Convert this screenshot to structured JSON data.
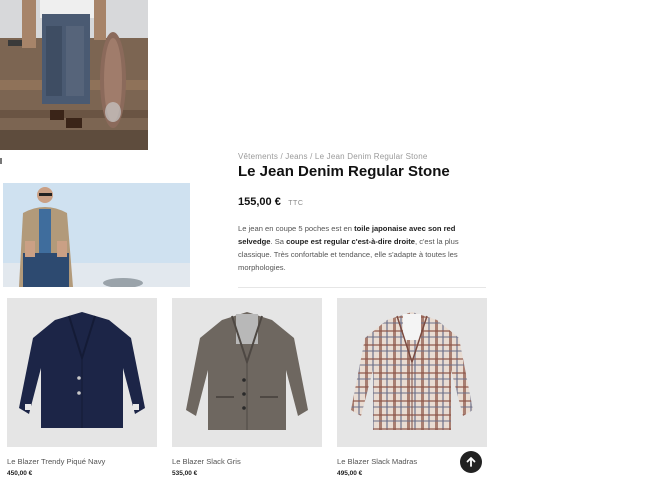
{
  "product": {
    "breadcrumb": "Vêtements / Jeans / Le Jean Denim Regular Stone",
    "title": "Le Jean Denim Regular Stone",
    "price": "155,00 €",
    "price_suffix": "TTC",
    "description": {
      "p1": "Le jean en coupe 5 poches est en ",
      "b1": "toile japonaise avec son red selvedge",
      "p2": ". Sa ",
      "b2": "coupe est regular c'est-à-dire droite",
      "p3": ", c'est la plus classique. Très confortable et tendance, elle s'adapte à toutes les morphologies."
    }
  },
  "related": [
    {
      "name": "Le Blazer Trendy Piqué Navy",
      "price": "450,00 €"
    },
    {
      "name": "Le Blazer Slack Gris",
      "price": "535,00 €"
    },
    {
      "name": "Le Blazer Slack Madras",
      "price": "495,00 €"
    }
  ],
  "colors": {
    "navy": "#1c2547",
    "grey_tweed": "#6e6760",
    "madras_base": "#e9dcd2",
    "thumb_bg": "#e5e5e5",
    "scroll_btn": "#222222"
  },
  "icons": {
    "scroll_top": "arrow-up-icon"
  }
}
